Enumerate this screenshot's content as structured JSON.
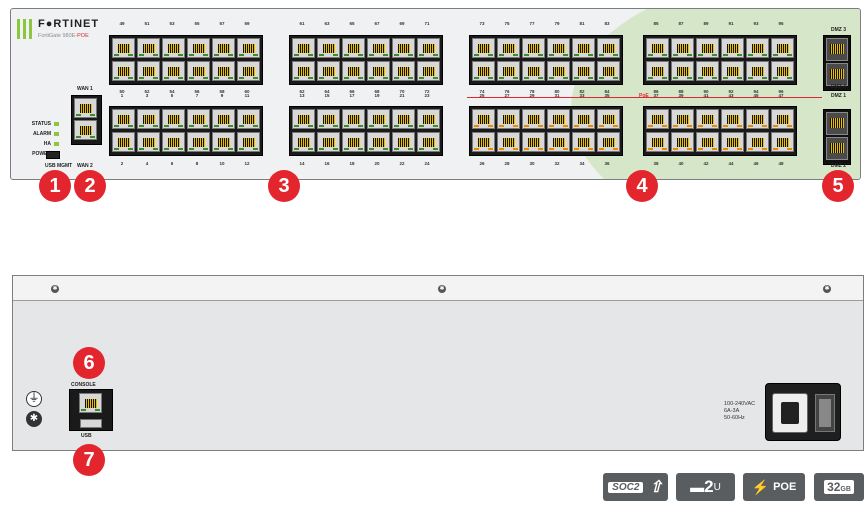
{
  "front_panel": {
    "brand": "F●RTINET",
    "model_prefix": "FortiGate 980E-",
    "model_suffix": "POE",
    "leds": [
      "STATUS",
      "ALARM",
      "HA",
      "POWER"
    ],
    "usb_mgmt_label": "USB MGMT",
    "wan_top_label": "WAN 1",
    "wan_bottom_label": "WAN 2",
    "poe_label": "PoE",
    "sfp_labels": [
      "DMZ 3",
      "DMZ 4",
      "DMZ 1",
      "DMZ 2"
    ],
    "port_labels_row1_top": [
      "49",
      "51",
      "53",
      "55",
      "57",
      "59",
      "61",
      "63",
      "65",
      "67",
      "69",
      "71",
      "73",
      "75",
      "77",
      "79",
      "81",
      "83",
      "85",
      "87",
      "89",
      "91",
      "93",
      "95"
    ],
    "port_labels_row1_bottom": [
      "50",
      "52",
      "54",
      "56",
      "58",
      "60",
      "62",
      "64",
      "66",
      "68",
      "70",
      "72",
      "74",
      "76",
      "78",
      "80",
      "82",
      "84",
      "86",
      "88",
      "90",
      "92",
      "94",
      "96"
    ],
    "port_labels_row2_top": [
      "1",
      "3",
      "5",
      "7",
      "9",
      "11",
      "13",
      "15",
      "17",
      "19",
      "21",
      "23",
      "25",
      "27",
      "29",
      "31",
      "33",
      "35",
      "37",
      "39",
      "41",
      "43",
      "45",
      "47"
    ],
    "port_labels_row2_bottom": [
      "2",
      "4",
      "6",
      "8",
      "10",
      "12",
      "14",
      "16",
      "18",
      "20",
      "22",
      "24",
      "26",
      "28",
      "30",
      "32",
      "34",
      "36",
      "38",
      "40",
      "42",
      "44",
      "46",
      "48"
    ]
  },
  "rear_panel": {
    "console_label": "CONSOLE",
    "usb_label": "USB",
    "power_spec_lines": [
      "100-240VAC",
      "6A-3A",
      "50-60Hz"
    ]
  },
  "callouts": [
    "1",
    "2",
    "3",
    "4",
    "5",
    "6",
    "7"
  ],
  "badges": {
    "soc": "SOC2",
    "rack": "2",
    "rack_unit": "U",
    "poe": "POE",
    "storage": "32",
    "storage_unit": "GB"
  },
  "colors": {
    "accent_green": "#8cc63f",
    "callout_red": "#e3262e",
    "poe_orange": "#e88b00"
  }
}
